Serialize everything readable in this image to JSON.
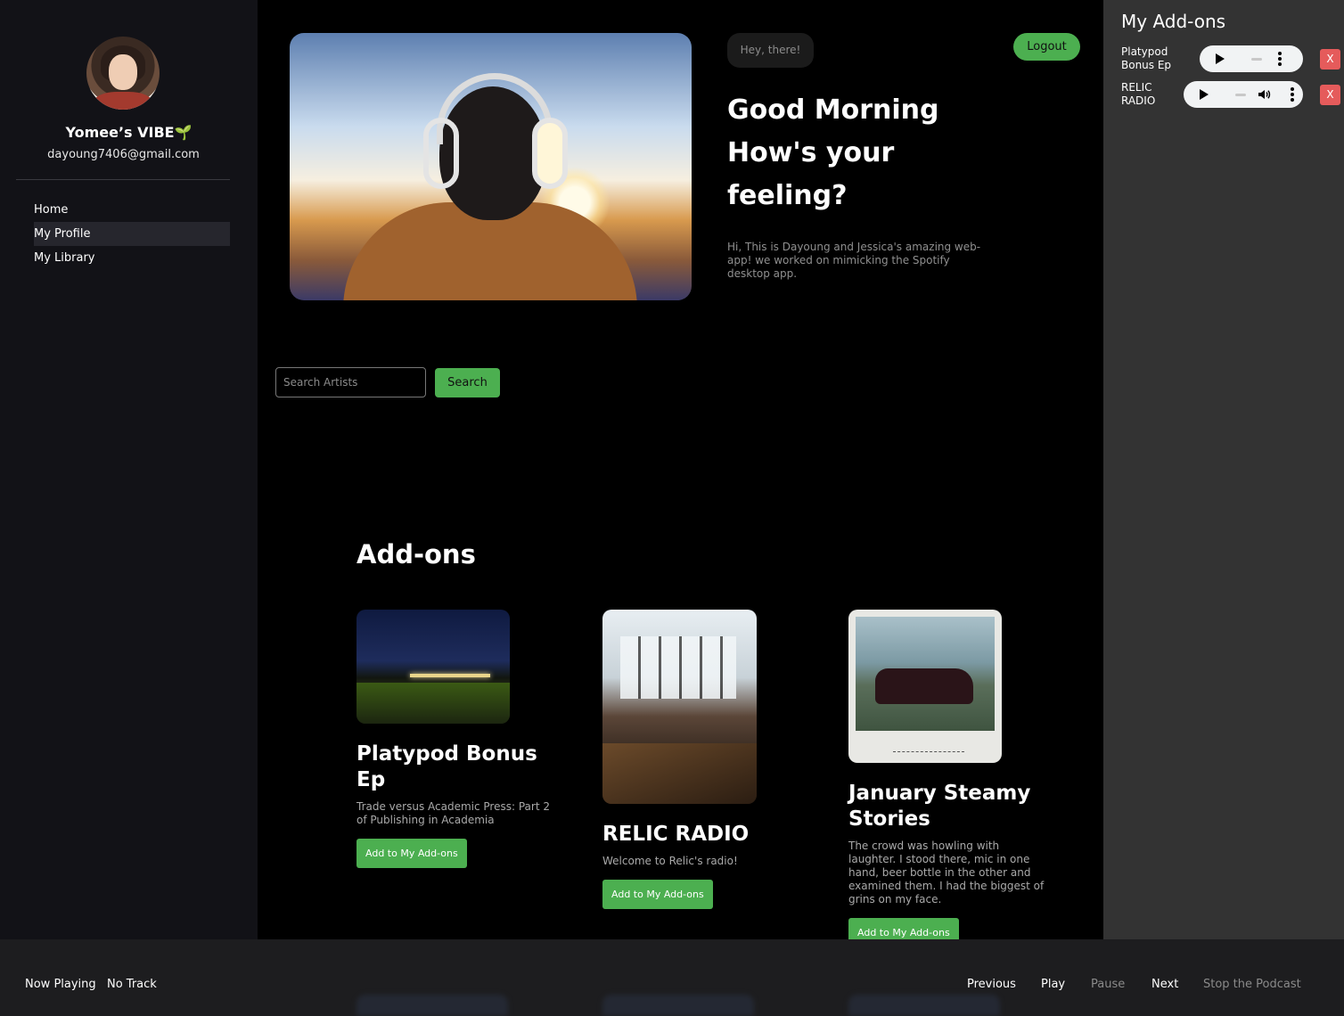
{
  "sidebar": {
    "profile_name": "Yomee’s VIBE🌱",
    "profile_email": "dayoung7406@gmail.com",
    "nav": [
      {
        "label": "Home"
      },
      {
        "label": "My Profile",
        "active": true
      },
      {
        "label": "My Library"
      }
    ]
  },
  "main": {
    "greeting_pill": "Hey, there!",
    "logout_label": "Logout",
    "headline": [
      "Good Morning",
      "How's your",
      "feeling?"
    ],
    "intro": "Hi, This is Dayoung and Jessica's amazing web-app! we worked on mimicking the Spotify desktop app.",
    "search": {
      "placeholder": "Search Artists",
      "button_label": "Search"
    },
    "addons_title": "Add-ons",
    "cards": [
      {
        "title": "Platypod Bonus Ep",
        "description": "Trade versus Academic Press: Part 2 of Publishing in Academia",
        "button_label": "Add to My Add-ons"
      },
      {
        "title": "RELIC RADIO",
        "description": "Welcome to Relic's radio!",
        "button_label": "Add to My Add-ons"
      },
      {
        "title": "January Steamy Stories",
        "description": "The crowd was howling with laughter. I stood there, mic in one hand, beer bottle in the other and examined them. I had the biggest of grins on my face.",
        "button_label": "Add to My Add-ons"
      }
    ]
  },
  "right_panel": {
    "title": "My Add-ons",
    "items": [
      {
        "name": "Platypod Bonus Ep",
        "remove_label": "X"
      },
      {
        "name": "RELIC RADIO",
        "remove_label": "X"
      }
    ]
  },
  "footer": {
    "now_playing_label": "Now Playing",
    "track": "No Track",
    "controls": [
      {
        "label": "Previous",
        "enabled": true
      },
      {
        "label": "Play",
        "enabled": true
      },
      {
        "label": "Pause",
        "enabled": false
      },
      {
        "label": "Next",
        "enabled": true
      },
      {
        "label": "Stop the Podcast",
        "enabled": false
      }
    ]
  },
  "colors": {
    "accent_green": "#4caf50",
    "remove_red": "#e55b5b",
    "sidebar_bg": "#121217",
    "panel_bg": "#333333"
  }
}
